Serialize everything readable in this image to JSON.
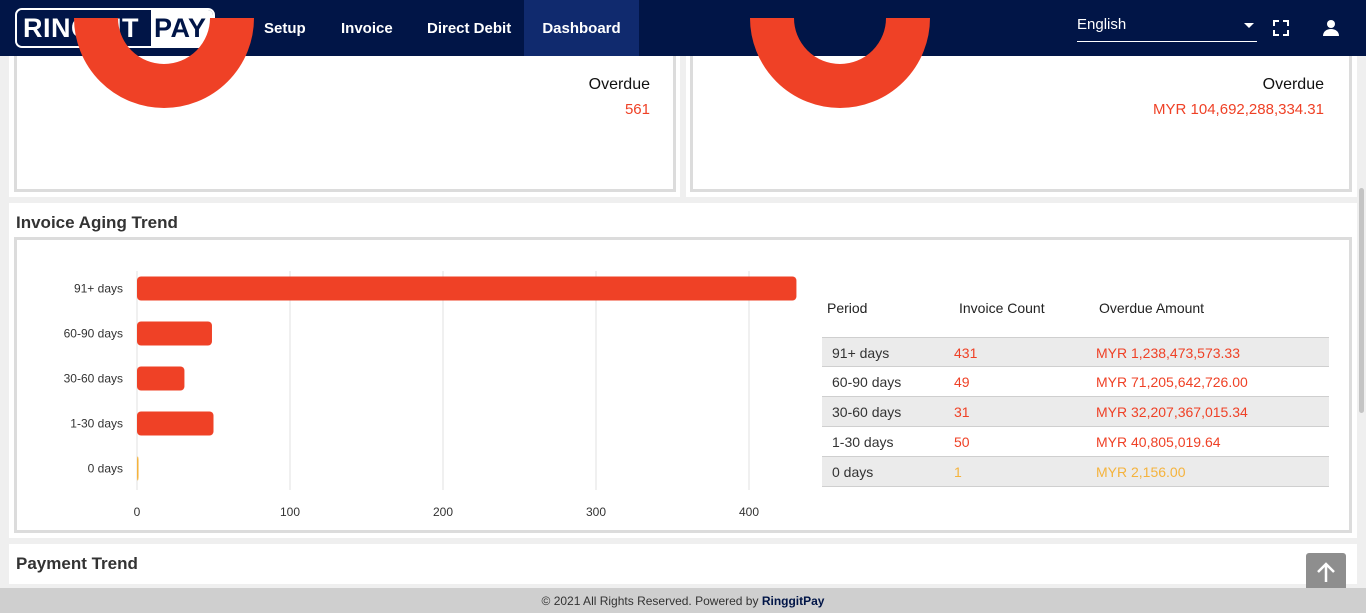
{
  "header": {
    "logo_left": "RINGGIT",
    "logo_right": "PAY",
    "nav": [
      {
        "label": "Setup"
      },
      {
        "label": "Invoice"
      },
      {
        "label": "Direct Debit"
      },
      {
        "label": "Dashboard",
        "active": true
      }
    ],
    "language": "English",
    "icons": [
      "fullscreen-icon",
      "user-icon"
    ]
  },
  "summary_cards": [
    {
      "label": "Overdue",
      "value": "561"
    },
    {
      "label": "Overdue",
      "value": "MYR 104,692,288,334.31"
    }
  ],
  "aging": {
    "title": "Invoice Aging Trend",
    "table_headers": {
      "period": "Period",
      "count": "Invoice Count",
      "amount": "Overdue Amount"
    },
    "rows": [
      {
        "period": "91+ days",
        "count": "431",
        "amount": "MYR 1,238,473,573.33"
      },
      {
        "period": "60-90 days",
        "count": "49",
        "amount": "MYR 71,205,642,726.00"
      },
      {
        "period": "30-60 days",
        "count": "31",
        "amount": "MYR 32,207,367,015.34"
      },
      {
        "period": "1-30 days",
        "count": "50",
        "amount": "MYR 40,805,019.64"
      },
      {
        "period": "0 days",
        "count": "1",
        "amount": "MYR 2,156.00"
      }
    ]
  },
  "chart_data": {
    "type": "bar",
    "orientation": "horizontal",
    "categories": [
      "91+ days",
      "60-90 days",
      "30-60 days",
      "1-30 days",
      "0 days"
    ],
    "values": [
      431,
      49,
      31,
      50,
      1
    ],
    "xlim": [
      0,
      430
    ],
    "xticks": [
      0,
      100,
      200,
      300,
      400
    ],
    "grid": true,
    "colors": [
      "#ef4126",
      "#ef4126",
      "#ef4126",
      "#ef4126",
      "#f5b33d"
    ]
  },
  "payment_trend": {
    "title": "Payment Trend"
  },
  "footer": {
    "text": "© 2021 All Rights Reserved. Powered by ",
    "brand": "RinggitPay"
  },
  "colors": {
    "navy": "#011547",
    "accent": "#ef4126",
    "amber": "#f5b33d"
  }
}
